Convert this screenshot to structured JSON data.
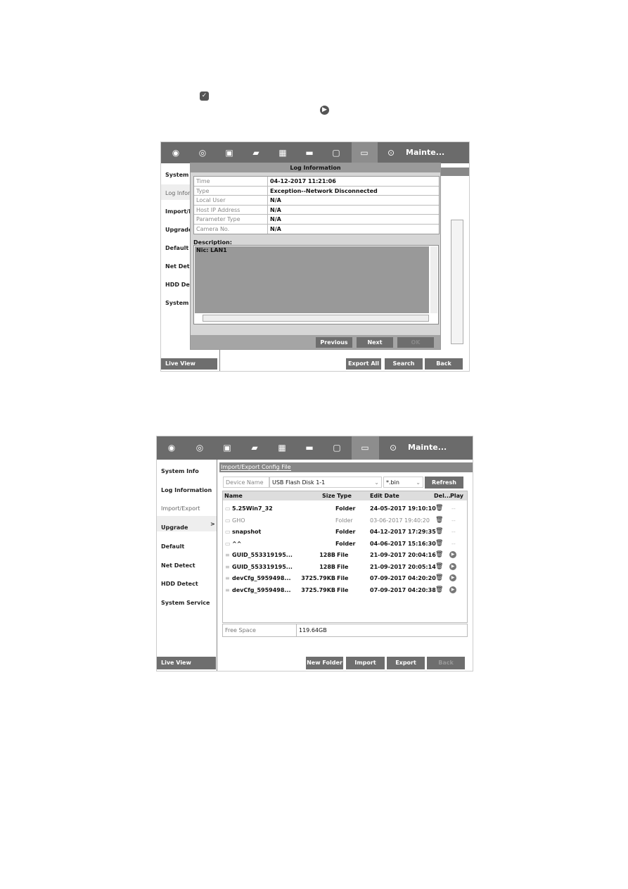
{
  "doc_icons": {
    "check": "check-icon",
    "play": "play-icon"
  },
  "shot1": {
    "menu_title": "Mainte...",
    "sidebar": [
      "System In",
      "Log Inform",
      "Import/Ex",
      "Upgrade",
      "Default",
      "Net Detec",
      "HDD Dete",
      "System Se"
    ],
    "live_view": "Live View",
    "dialog": {
      "title": "Log Information",
      "rows": [
        {
          "k": "Time",
          "v": "04-12-2017 11:21:06"
        },
        {
          "k": "Type",
          "v": "Exception--Network Disconnected"
        },
        {
          "k": "Local User",
          "v": "N/A"
        },
        {
          "k": "Host IP Address",
          "v": "N/A"
        },
        {
          "k": "Parameter Type",
          "v": "N/A"
        },
        {
          "k": "Camera No.",
          "v": "N/A"
        }
      ],
      "description_label": "Description:",
      "description": "Nic: LAN1",
      "previous": "Previous",
      "next": "Next",
      "ok": "OK"
    },
    "export_all": "Export All",
    "search": "Search",
    "back": "Back"
  },
  "shot2": {
    "menu_title": "Mainte...",
    "sidebar": [
      "System Info",
      "Log Information",
      "Import/Export",
      "Upgrade",
      "Default",
      "Net Detect",
      "HDD Detect",
      "System Service"
    ],
    "selected_arrow": ">",
    "live_view": "Live View",
    "tab": "Import/Export Config File",
    "device_label": "Device Name",
    "device_value": "USB Flash Disk 1-1",
    "filter": "*.bin",
    "refresh": "Refresh",
    "headers": {
      "name": "Name",
      "size": "Size",
      "type": "Type",
      "date": "Edit Date",
      "del": "Del...",
      "play": "Play"
    },
    "files": [
      {
        "name": "5.25Win7_32",
        "size": "",
        "type": "Folder",
        "date": "24-05-2017 19:10:10",
        "play": "--"
      },
      {
        "name": "GHO",
        "size": "",
        "type": "Folder",
        "date": "03-06-2017 19:40:20",
        "play": "--"
      },
      {
        "name": "snapshot",
        "size": "",
        "type": "Folder",
        "date": "04-12-2017 17:29:35",
        "play": "--"
      },
      {
        "name": "^^",
        "size": "",
        "type": "Folder",
        "date": "04-06-2017 15:16:30",
        "play": "--"
      },
      {
        "name": "GUID_553319195...",
        "size": "128B",
        "type": "File",
        "date": "21-09-2017 20:04:16",
        "play": ""
      },
      {
        "name": "GUID_553319195...",
        "size": "128B",
        "type": "File",
        "date": "21-09-2017 20:05:14",
        "play": ""
      },
      {
        "name": "devCfg_5959498...",
        "size": "3725.79KB",
        "type": "File",
        "date": "07-09-2017 04:20:20",
        "play": ""
      },
      {
        "name": "devCfg_5959498...",
        "size": "3725.79KB",
        "type": "File",
        "date": "07-09-2017 04:20:38",
        "play": ""
      }
    ],
    "free_space_label": "Free Space",
    "free_space": "119.64GB",
    "new_folder": "New Folder",
    "import": "Import",
    "export": "Export",
    "back": "Back"
  }
}
